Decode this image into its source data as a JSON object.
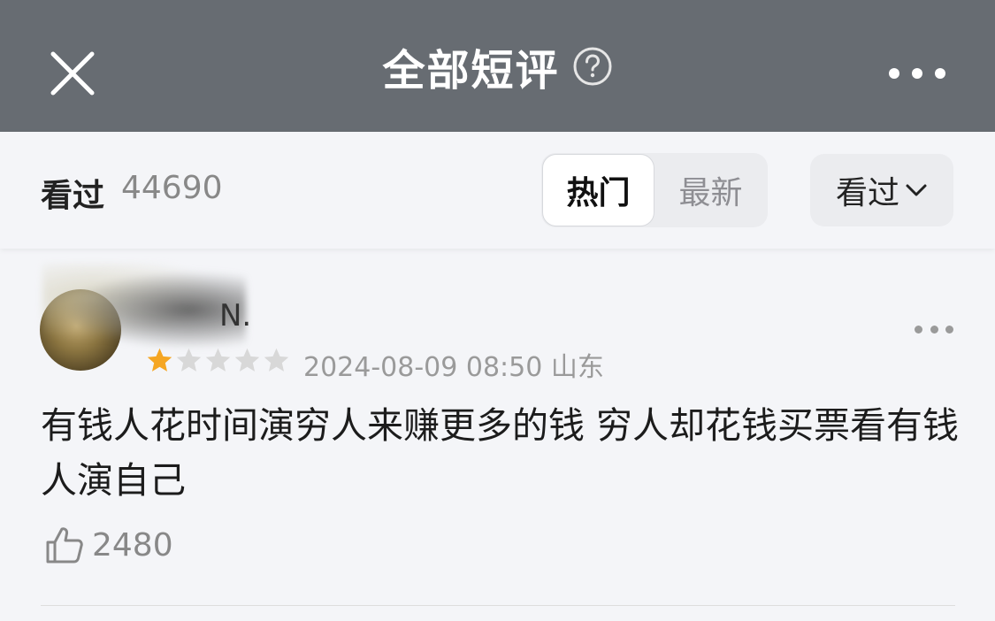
{
  "header": {
    "title": "全部短评",
    "close_icon": "close-icon",
    "help_icon": "question-circle-icon",
    "more_icon": "more-horizontal-icon",
    "background": "#676c72"
  },
  "filter": {
    "status_label": "看过",
    "count": "44690",
    "tabs": [
      {
        "label": "热门",
        "selected": true
      },
      {
        "label": "最新",
        "selected": false
      }
    ],
    "dropdown_label": "看过",
    "dropdown_icon": "chevron-down-icon"
  },
  "review": {
    "username_visible": "N.",
    "rating": 1,
    "max_rating": 5,
    "star_color": "#f5a623",
    "date": "2024-08-09 08:50",
    "location": "山东",
    "text": "有钱人花时间演穷人来赚更多的钱 穷人却花钱买票看有钱人演自己",
    "likes": "2480",
    "like_icon": "thumbs-up-icon",
    "more_icon": "more-horizontal-icon"
  }
}
